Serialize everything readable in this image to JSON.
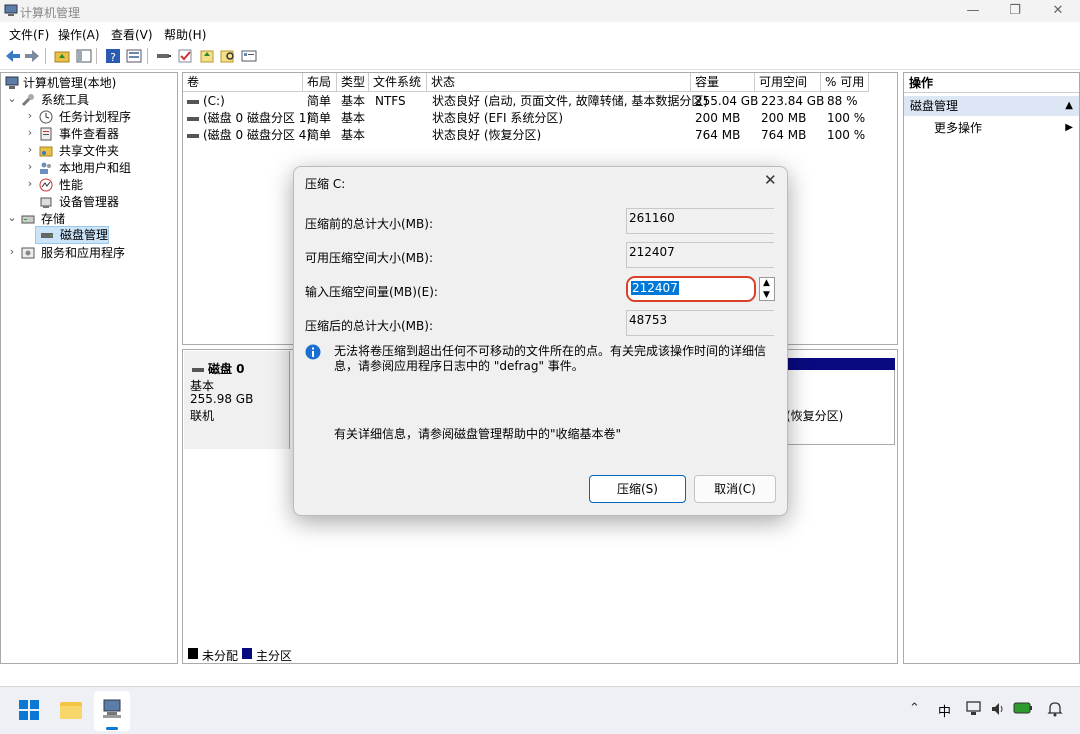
{
  "window": {
    "title": "计算机管理"
  },
  "menu": [
    "文件(F)",
    "操作(A)",
    "查看(V)",
    "帮助(H)"
  ],
  "tree": {
    "root": "计算机管理(本地)",
    "system_tools": "系统工具",
    "task_scheduler": "任务计划程序",
    "event_viewer": "事件查看器",
    "shared_folders": "共享文件夹",
    "local_users": "本地用户和组",
    "performance": "性能",
    "device_manager": "设备管理器",
    "storage": "存储",
    "disk_management": "磁盘管理",
    "services_apps": "服务和应用程序"
  },
  "table": {
    "headers": [
      "卷",
      "布局",
      "类型",
      "文件系统",
      "状态",
      "容量",
      "可用空间",
      "% 可用"
    ],
    "rows": [
      [
        "(C:)",
        "简单",
        "基本",
        "NTFS",
        "状态良好 (启动, 页面文件, 故障转储, 基本数据分区)",
        "255.04 GB",
        "223.84 GB",
        "88 %"
      ],
      [
        "(磁盘 0 磁盘分区 1)",
        "简单",
        "基本",
        "",
        "状态良好 (EFI 系统分区)",
        "200 MB",
        "200 MB",
        "100 %"
      ],
      [
        "(磁盘 0 磁盘分区 4)",
        "简单",
        "基本",
        "",
        "状态良好 (恢复分区)",
        "764 MB",
        "764 MB",
        "100 %"
      ]
    ]
  },
  "disk": {
    "name": "磁盘 0",
    "type": "基本",
    "size": "255.98 GB",
    "status": "联机",
    "partition_tail": "(恢复分区)"
  },
  "legend": {
    "unallocated": "未分配",
    "primary": "主分区"
  },
  "actions": {
    "header": "操作",
    "section": "磁盘管理",
    "more": "更多操作"
  },
  "dialog": {
    "title": "压缩 C:",
    "total_before_label": "压缩前的总计大小(MB):",
    "total_before_value": "261160",
    "available_label": "可用压缩空间大小(MB):",
    "available_value": "212407",
    "input_label": "输入压缩空间量(MB)(E):",
    "input_value": "212407",
    "total_after_label": "压缩后的总计大小(MB):",
    "total_after_value": "48753",
    "info_text": "无法将卷压缩到超出任何不可移动的文件所在的点。有关完成该操作时间的详细信息，请参阅应用程序日志中的 \"defrag\" 事件。",
    "help_text": "有关详细信息，请参阅磁盘管理帮助中的\"收缩基本卷\"",
    "shrink_button": "压缩(S)",
    "cancel_button": "取消(C)"
  },
  "taskbar": {
    "ime": "中"
  },
  "colors": {
    "primary_partition": "#0a0a80",
    "selection": "#0078d7",
    "highlight_ring": "#d9412a",
    "actions_header": "#dce6f4"
  }
}
